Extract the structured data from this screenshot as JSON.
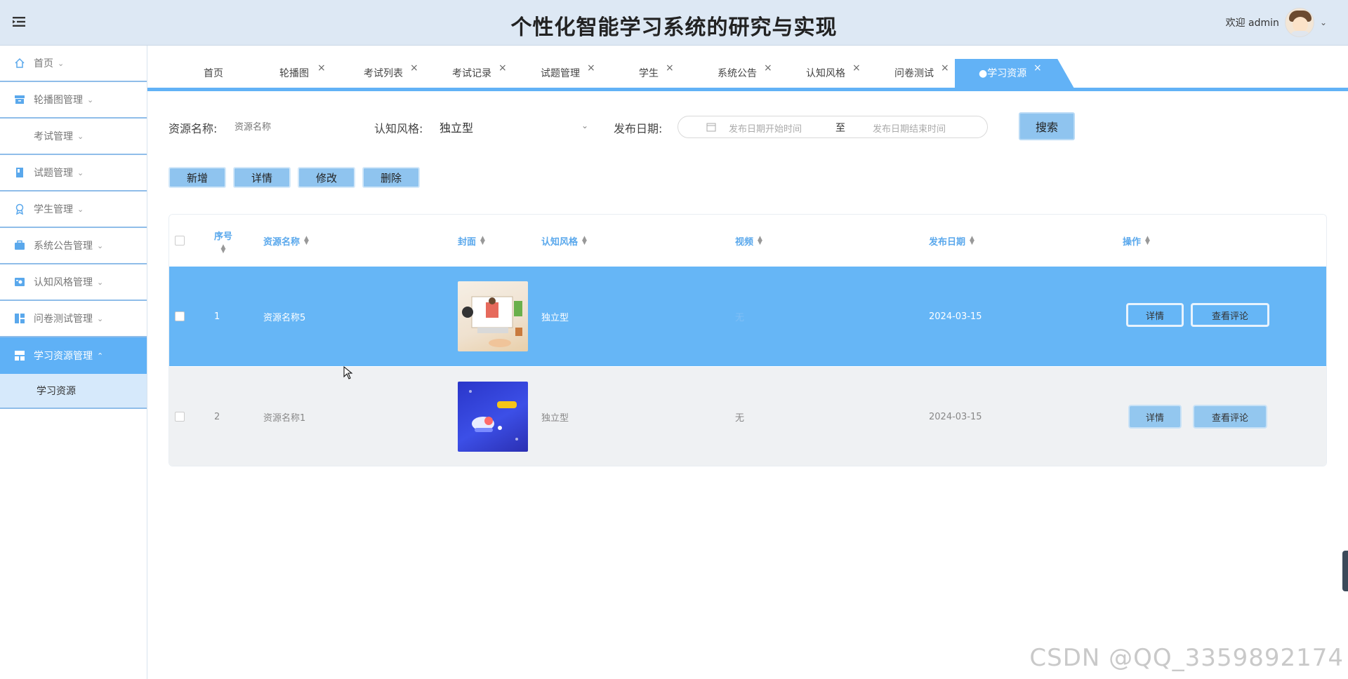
{
  "header": {
    "title": "个性化智能学习系统的研究与实现",
    "welcome": "欢迎 admin",
    "user_chevron": "⌄"
  },
  "sidebar": {
    "items": [
      {
        "label": "首页",
        "icon": "home-icon"
      },
      {
        "label": "轮播图管理",
        "icon": "carousel-icon"
      },
      {
        "label": "考试管理",
        "icon": ""
      },
      {
        "label": "试题管理",
        "icon": "book-icon"
      },
      {
        "label": "学生管理",
        "icon": "student-icon"
      },
      {
        "label": "系统公告管理",
        "icon": "briefcase-icon"
      },
      {
        "label": "认知风格管理",
        "icon": "settings-card-icon"
      },
      {
        "label": "问卷测试管理",
        "icon": "layout-icon"
      },
      {
        "label": "学习资源管理",
        "icon": "grid-icon"
      }
    ],
    "active_sub": "学习资源"
  },
  "tabs": [
    {
      "label": "首页"
    },
    {
      "label": "轮播图"
    },
    {
      "label": "考试列表"
    },
    {
      "label": "考试记录"
    },
    {
      "label": "试题管理"
    },
    {
      "label": "学生"
    },
    {
      "label": "系统公告"
    },
    {
      "label": "认知风格"
    },
    {
      "label": "问卷测试"
    },
    {
      "label": "●学习资源"
    }
  ],
  "search": {
    "name_label": "资源名称:",
    "name_placeholder": "资源名称",
    "style_label": "认知风格:",
    "style_value": "独立型",
    "date_label": "发布日期:",
    "date_start_placeholder": "发布日期开始时间",
    "date_sep": "至",
    "date_end_placeholder": "发布日期结束时间",
    "button": "搜索"
  },
  "actions": {
    "add": "新增",
    "detail": "详情",
    "edit": "修改",
    "delete": "删除"
  },
  "table": {
    "columns": [
      "序号",
      "资源名称",
      "封面",
      "认知风格",
      "视频",
      "发布日期",
      "操作"
    ],
    "rows": [
      {
        "index": "1",
        "name": "资源名称5",
        "style": "独立型",
        "video": "无",
        "date": "2024-03-15",
        "op_detail": "详情",
        "op_comments": "查看评论"
      },
      {
        "index": "2",
        "name": "资源名称1",
        "style": "独立型",
        "video": "无",
        "date": "2024-03-15",
        "op_detail": "详情",
        "op_comments": "查看评论"
      }
    ]
  },
  "watermark": "CSDN @QQ_3359892174",
  "colors": {
    "accent": "#62b2f6",
    "header_bg": "#dde8f4",
    "button": "#8fc4ef",
    "row_selected": "#66b6f6"
  }
}
